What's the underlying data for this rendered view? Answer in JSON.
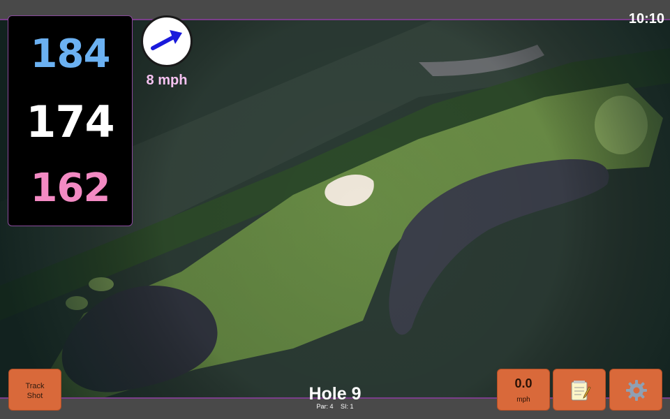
{
  "status": {
    "time": "10:10"
  },
  "distances": {
    "back": "184",
    "middle": "174",
    "front": "162"
  },
  "wind": {
    "speed_label": "8 mph",
    "arrow_icon": "wind-direction-arrow-icon",
    "arrow_color": "#1a1adb"
  },
  "hole": {
    "title": "Hole 9",
    "par": "Par: 4",
    "stroke_index": "SI: 1"
  },
  "buttons": {
    "track_shot_line1": "Track",
    "track_shot_line2": "Shot",
    "speed_value": "0.0",
    "speed_unit": "mph",
    "notes_icon": "notepad-icon",
    "settings_icon": "gear-icon"
  },
  "colors": {
    "back_distance": "#6bb1f2",
    "middle_distance": "#ffffff",
    "front_distance": "#f38ac3",
    "button_bg": "#d9693a",
    "accent_border": "#7a3e8a",
    "wind_label": "#f7c3f2"
  }
}
